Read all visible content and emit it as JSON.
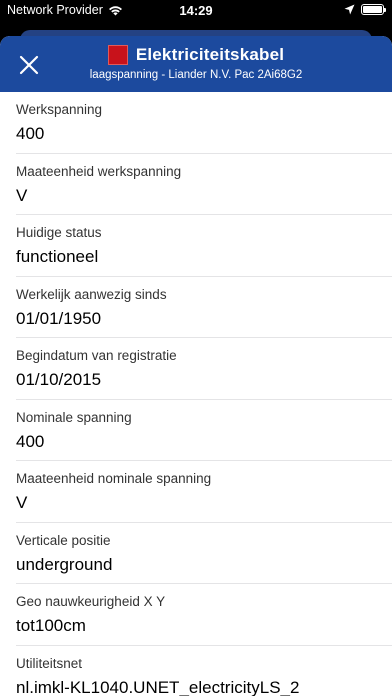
{
  "status_bar": {
    "carrier": "Network Provider",
    "time": "14:29"
  },
  "header": {
    "title": "Elektriciteitskabel",
    "subtitle": "laagspanning - Liander N.V. Pac 2Ai68G2",
    "swatch_color": "#c8121b",
    "background_color": "#1c4a9e"
  },
  "fields": [
    {
      "label": "Werkspanning",
      "value": "400"
    },
    {
      "label": "Maateenheid werkspanning",
      "value": "V"
    },
    {
      "label": "Huidige status",
      "value": "functioneel"
    },
    {
      "label": "Werkelijk aanwezig sinds",
      "value": "01/01/1950"
    },
    {
      "label": "Begindatum van registratie",
      "value": "01/10/2015"
    },
    {
      "label": "Nominale spanning",
      "value": "400"
    },
    {
      "label": "Maateenheid nominale spanning",
      "value": "V"
    },
    {
      "label": "Verticale positie",
      "value": "underground"
    },
    {
      "label": "Geo nauwkeurigheid X Y",
      "value": "tot100cm"
    },
    {
      "label": "Utiliteitsnet",
      "value": "nl.imkl-KL1040.UNET_electricityLS_2"
    }
  ]
}
